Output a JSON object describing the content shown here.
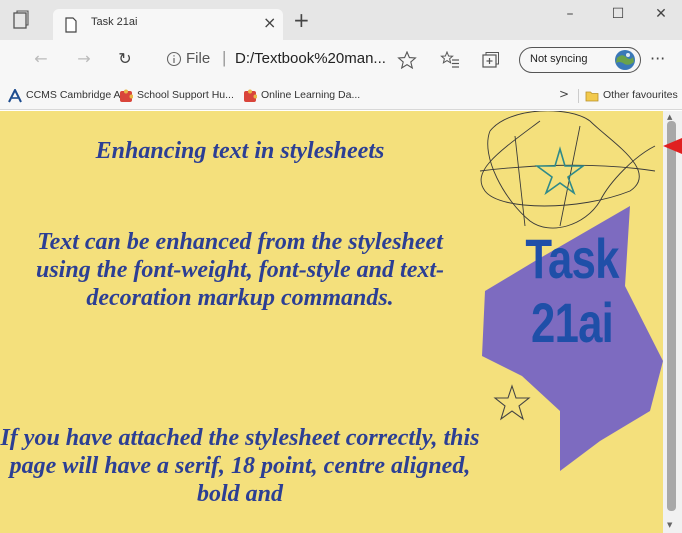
{
  "tab": {
    "title": "Task 21ai",
    "close": "×"
  },
  "new_tab": "+",
  "window_controls": {
    "minimize": "–",
    "maximize": "☐",
    "close": "✕"
  },
  "address_bar": {
    "protocol": "File",
    "separator": "|",
    "url": "D:/Textbook%20man..."
  },
  "sync": {
    "label": "Not syncing"
  },
  "more": "···",
  "bookmarks": [
    {
      "label": "CCMS Cambridge A...",
      "icon": "cambridge-icon"
    },
    {
      "label": "School Support Hu...",
      "icon": "puzzle-icon"
    },
    {
      "label": "Online Learning Da...",
      "icon": "puzzle-icon"
    }
  ],
  "bookmarks_overflow": ">",
  "other_favourites": "Other favourites",
  "page": {
    "heading": "Enhancing text in stylesheets",
    "para1": "Text can be enhanced from the stylesheet using the font-weight, font-style and text-decoration markup commands.",
    "para2": "If you have attached the stylesheet correctly, this page will have a serif, 18 point, centre aligned, bold and",
    "logo_line1": "Task",
    "logo_line2": "21ai"
  },
  "colors": {
    "page_bg": "#f4e07c",
    "text": "#2c3f94",
    "star": "#7d6bc0",
    "logo": "#1f4fa8",
    "annotation_arrow": "#e02020"
  }
}
